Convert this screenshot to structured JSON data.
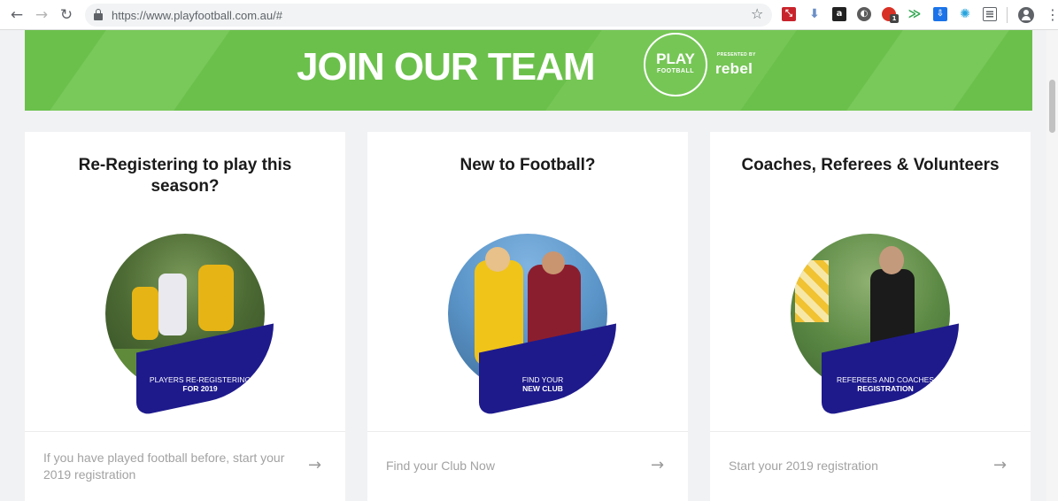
{
  "browser": {
    "url": "https://www.playfootball.com.au/#",
    "extension_labels": {
      "amazon": "a",
      "badge_count": "1"
    }
  },
  "banner": {
    "title": "JOIN OUR TEAM",
    "logo_play": "PLAY",
    "logo_football": "FOOTBALL",
    "presented_by": "PRESENTED BY",
    "sponsor": "rebel",
    "background_color": "#6bc04b"
  },
  "cards": [
    {
      "title": "Re-Registering to play this season?",
      "caption_line1": "PLAYERS RE-REGISTERING",
      "caption_line2": "FOR 2019",
      "footer_text": "If you have played football before, start your 2019 registration"
    },
    {
      "title": "New to Football?",
      "caption_line1": "FIND YOUR",
      "caption_line2": "NEW CLUB",
      "footer_text": "Find your Club Now"
    },
    {
      "title": "Coaches, Referees & Volunteers",
      "caption_line1": "REFEREES AND COACHES",
      "caption_line2": "REGISTRATION",
      "footer_text": "Start your 2019 registration"
    }
  ],
  "colors": {
    "accent_navy": "#1e1a8c",
    "page_bg": "#f1f2f3"
  }
}
